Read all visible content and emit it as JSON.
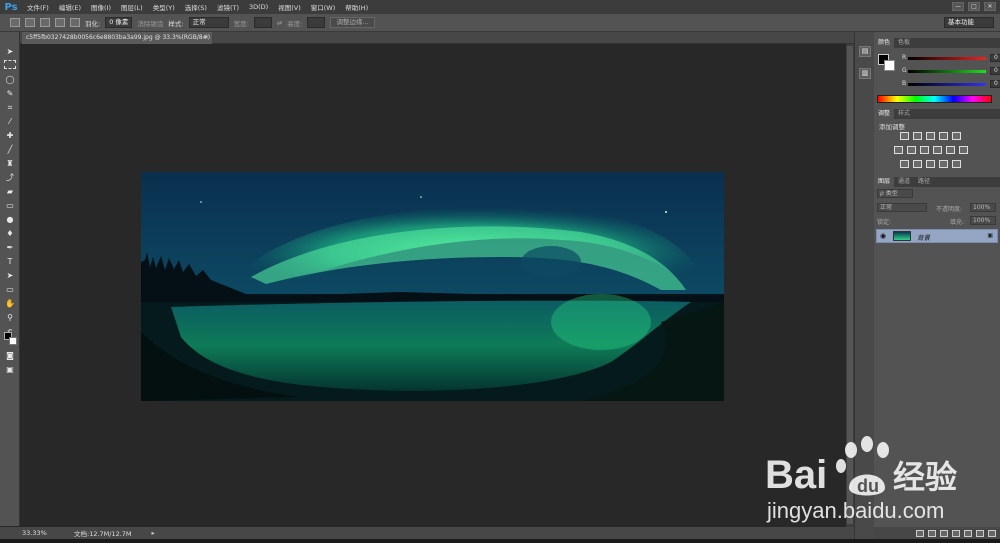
{
  "app": {
    "logo": "Ps"
  },
  "menu": [
    "文件(F)",
    "编辑(E)",
    "图像(I)",
    "图层(L)",
    "类型(Y)",
    "选择(S)",
    "滤镜(T)",
    "3D(D)",
    "视图(V)",
    "窗口(W)",
    "帮助(H)"
  ],
  "window_controls": [
    "—",
    "□",
    "✕"
  ],
  "options": {
    "feather_label": "羽化:",
    "feather_value": "0 像素",
    "antialias_label": "消除锯齿",
    "style_label": "样式:",
    "style_value": "正常",
    "width_label": "宽度:",
    "height_label": "高度:",
    "refine_edge_button": "调整边缘...",
    "workspace": "基本功能"
  },
  "document": {
    "tab_title": "c5ff5fb0327428b0056c6e8803ba3a99.jpg @ 33.3%(RGB/8#)",
    "close": "×"
  },
  "status": {
    "zoom": "33.33%",
    "doc_info": "文档:12.7M/12.7M",
    "arrow": "▸"
  },
  "color_panel": {
    "tabs": [
      "颜色",
      "色板"
    ],
    "channels": [
      {
        "label": "R",
        "value": "0",
        "color": "#d33"
      },
      {
        "label": "G",
        "value": "0",
        "color": "#3c3"
      },
      {
        "label": "B",
        "value": "0",
        "color": "#33d"
      }
    ]
  },
  "adjust_panel": {
    "tabs": [
      "调整",
      "样式"
    ],
    "title": "添加调整"
  },
  "layers_panel": {
    "tabs": [
      "图层",
      "通道",
      "路径"
    ],
    "filter_label": "ρ 类型",
    "blend_mode": "正常",
    "opacity_label": "不透明度:",
    "opacity_value": "100%",
    "lock_label": "锁定:",
    "fill_label": "填充:",
    "fill_value": "100%",
    "layer_name": "背景"
  },
  "icons": {
    "eye": "eye-icon",
    "lock": "lock-icon",
    "close": "close-icon"
  },
  "colors": {
    "accent": "#3aa0e8",
    "canvas_bg": "#282828",
    "panel_bg": "#535353",
    "layer_selected": "#94a6c3"
  },
  "watermark": {
    "brand": "Bai du 经验",
    "url": "jingyan.baidu.com"
  }
}
